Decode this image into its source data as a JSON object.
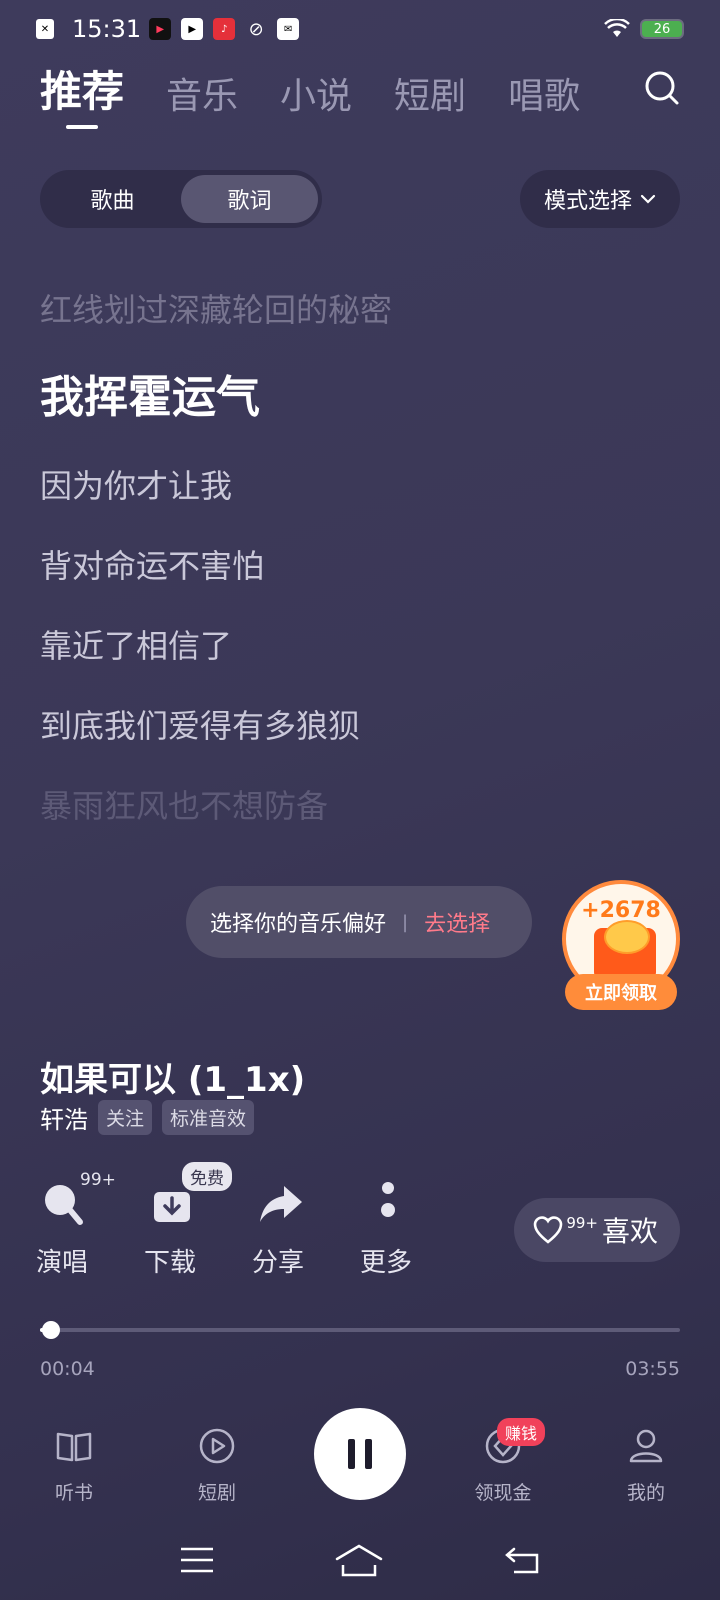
{
  "status_bar": {
    "time": "15:31",
    "notification_icons": [
      "sim-icon",
      "video-icon",
      "play-circle-icon",
      "app-icon",
      "link-icon",
      "message-icon"
    ],
    "battery": "26"
  },
  "tabs": [
    {
      "label": "推荐",
      "active": true
    },
    {
      "label": "音乐",
      "active": false
    },
    {
      "label": "小说",
      "active": false
    },
    {
      "label": "短剧",
      "active": false
    },
    {
      "label": "唱歌",
      "active": false
    }
  ],
  "segment": {
    "song": "歌曲",
    "lyrics": "歌词",
    "selected": "歌词"
  },
  "mode_select": "模式选择",
  "lyrics": [
    "红线划过深藏轮回的秘密",
    "我挥霍运气",
    "因为你才让我",
    "背对命运不害怕",
    "靠近了相信了",
    "到底我们爱得有多狼狈",
    "暴雨狂风也不想防备"
  ],
  "preference": {
    "text": "选择你的音乐偏好",
    "separator": "|",
    "action": "去选择"
  },
  "reward": {
    "amount": "+2678",
    "claim": "立即领取"
  },
  "song": {
    "title": "如果可以 (1_1x)",
    "artist": "轩浩",
    "follow": "关注",
    "audio_effect": "标准音效"
  },
  "actions": {
    "sing": {
      "label": "演唱",
      "count": "99+"
    },
    "download": {
      "label": "下载",
      "badge": "免费"
    },
    "share": {
      "label": "分享"
    },
    "more": {
      "label": "更多"
    },
    "like": {
      "label": "喜欢",
      "count": "99+"
    }
  },
  "progress": {
    "current": "00:04",
    "total": "03:55",
    "fraction": 0.017
  },
  "bottom_nav": [
    {
      "label": "听书",
      "icon": "book-icon"
    },
    {
      "label": "短剧",
      "icon": "play-circle-icon"
    },
    {
      "label": "领现金",
      "icon": "coin-icon",
      "badge": "赚钱"
    },
    {
      "label": "我的",
      "icon": "user-icon"
    }
  ],
  "player_state": "playing",
  "colors": {
    "accent_pink": "#ff7a8a",
    "reward_orange": "#ff8c3a",
    "earn_red": "#f1415a"
  }
}
